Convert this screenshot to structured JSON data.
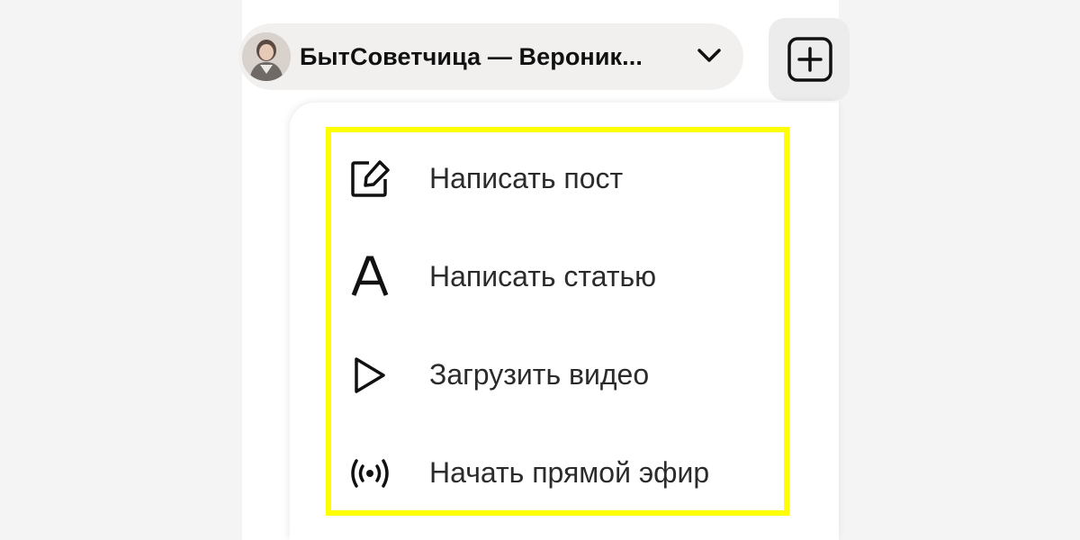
{
  "header": {
    "channel_name": "БытСоветчица — Вероник...",
    "avatar_icon": "user-avatar",
    "dropdown_icon": "chevron-down-icon",
    "add_button_icon": "plus-square-icon"
  },
  "menu": {
    "highlight_color": "#ffff00",
    "items": [
      {
        "label": "Написать пост",
        "icon": "edit-icon"
      },
      {
        "label": "Написать статью",
        "icon": "letter-a-icon"
      },
      {
        "label": "Загрузить видео",
        "icon": "play-icon"
      },
      {
        "label": "Начать прямой эфир",
        "icon": "broadcast-icon"
      }
    ]
  }
}
